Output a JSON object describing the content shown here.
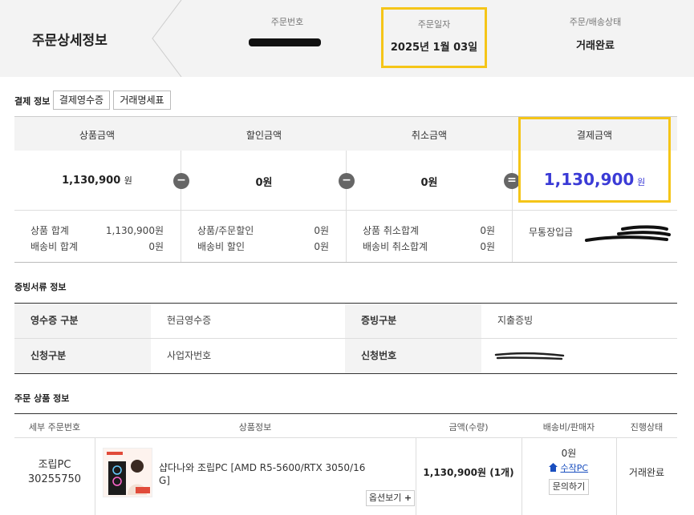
{
  "header": {
    "title": "주문상세정보",
    "order_number_label": "주문번호",
    "order_date_label": "주문일자",
    "order_date_value": "2025년 1월 03일",
    "status_label": "주문/배송상태",
    "status_value": "거래완료"
  },
  "payment": {
    "section_label": "결제 정보",
    "receipt_button": "결제영수증",
    "statement_button": "거래명세표",
    "columns": [
      "상품금액",
      "할인금액",
      "취소금액",
      "결제금액"
    ],
    "product_amount": "1,130,900",
    "won": "원",
    "discount_amount": "0원",
    "cancel_amount": "0원",
    "total_amount": "1,130,900",
    "operators": [
      "−",
      "−",
      "="
    ],
    "breakdown": {
      "product_total_label": "상품 합계",
      "product_total_value": "1,130,900원",
      "shipping_total_label": "배송비 합계",
      "shipping_total_value": "0원",
      "order_discount_label": "상품/주문할인",
      "order_discount_value": "0원",
      "shipping_discount_label": "배송비 할인",
      "shipping_discount_value": "0원",
      "product_cancel_label": "상품 취소합계",
      "product_cancel_value": "0원",
      "shipping_cancel_label": "배송비 취소합계",
      "shipping_cancel_value": "0원",
      "payment_method": "무통장입금"
    }
  },
  "documents": {
    "section_label": "증빙서류 정보",
    "receipt_type_label": "영수증 구분",
    "receipt_type_value": "현금영수증",
    "proof_type_label": "증빙구분",
    "proof_type_value": "지출증빙",
    "request_type_label": "신청구분",
    "request_type_value": "사업자번호",
    "request_number_label": "신청번호"
  },
  "order_items": {
    "section_label": "주문 상품 정보",
    "headers": [
      "세부 주문번호",
      "상품정보",
      "금액(수량)",
      "배송비/판매자",
      "진행상태"
    ],
    "items": [
      {
        "detail_no_line1": "조립PC",
        "detail_no_line2": "30255750",
        "name_line1": "샵다나와 조립PC [AMD R5-5600/RTX 3050/16",
        "name_line2": "G]",
        "options_button": "옵션보기",
        "price": "1,130,900원 (1개)",
        "shipping": "0원",
        "seller": "수작PC",
        "inquiry_button": "문의하기",
        "status": "거래완료"
      }
    ]
  },
  "colors": {
    "highlight": "#f5c518",
    "accent_price": "#3b3bd6",
    "link": "#1a4fbf"
  },
  "icons": {
    "seller_home": "home-icon",
    "plus": "plus-icon",
    "thumbnail": "product-thumbnail"
  }
}
